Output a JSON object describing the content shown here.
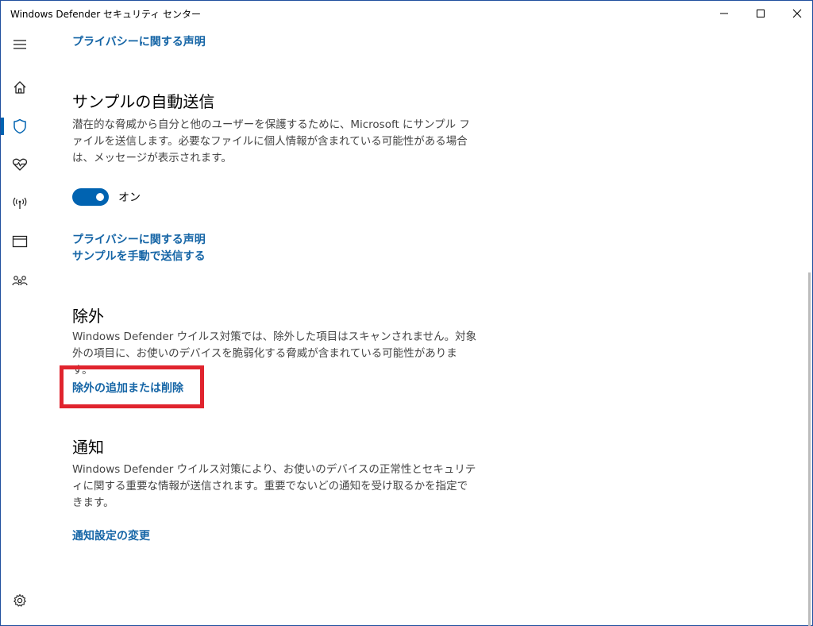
{
  "window": {
    "title": "Windows Defender セキュリティ センター"
  },
  "sidebar": {
    "items": [
      {
        "name": "menu",
        "icon": "hamburger-icon"
      },
      {
        "name": "home",
        "icon": "home-icon"
      },
      {
        "name": "virus-protection",
        "icon": "shield-icon",
        "active": true
      },
      {
        "name": "device-health",
        "icon": "heart-pulse-icon"
      },
      {
        "name": "firewall",
        "icon": "wireless-antenna-icon"
      },
      {
        "name": "app-browser",
        "icon": "browser-window-icon"
      },
      {
        "name": "family",
        "icon": "family-icon"
      },
      {
        "name": "settings",
        "icon": "gear-icon"
      }
    ]
  },
  "main": {
    "privacy_link_top": "プライバシーに関する声明",
    "sample_section": {
      "heading": "サンプルの自動送信",
      "description": "潜在的な脅威から自分と他のユーザーを保護するために、Microsoft にサンプル ファイルを送信します。必要なファイルに個人情報が含まれている可能性がある場合は、メッセージが表示されます。",
      "toggle_label": "オン",
      "toggle_on": true,
      "privacy_link": "プライバシーに関する声明",
      "manual_send_link": "サンプルを手動で送信する"
    },
    "exclusions_section": {
      "heading": "除外",
      "description": "Windows Defender ウイルス対策では、除外した項目はスキャンされません。対象外の項目に、お使いのデバイスを脆弱化する脅威が含まれている可能性があります。",
      "link": "除外の追加または削除"
    },
    "notifications_section": {
      "heading": "通知",
      "description": "Windows Defender ウイルス対策により、お使いのデバイスの正常性とセキュリティに関する重要な情報が送信されます。重要でないどの通知を受け取るかを指定できます。",
      "link": "通知設定の変更"
    }
  },
  "colors": {
    "accent": "#0063b1",
    "link": "#1565a6",
    "highlight_border": "#e0242e"
  }
}
